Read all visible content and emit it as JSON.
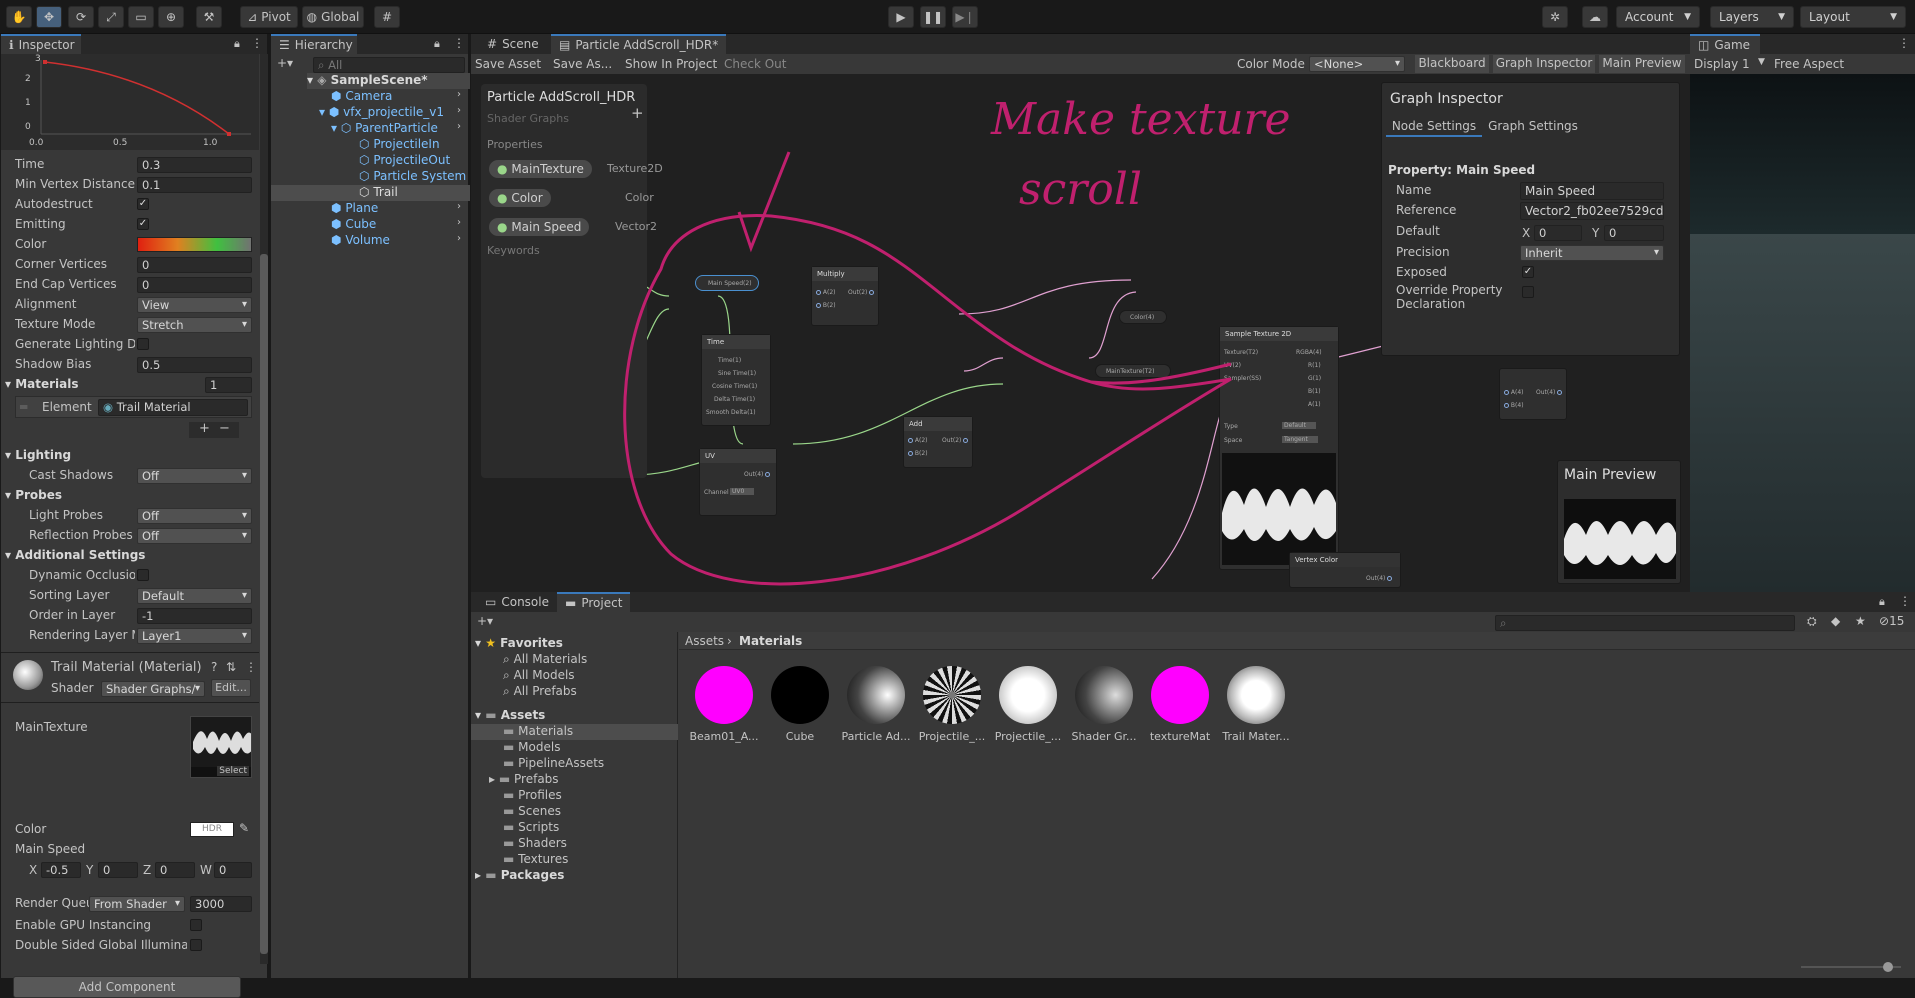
{
  "toolbar": {
    "pivot": "Pivot",
    "global": "Global",
    "account": "Account",
    "layers": "Layers",
    "layout": "Layout"
  },
  "inspector": {
    "tab": "Inspector",
    "curve_labels": {
      "y3": "3",
      "y2": "2",
      "y1": "1",
      "y0": "0",
      "x0": "0.0",
      "x05": "0.5",
      "x1": "1.0"
    },
    "props": [
      {
        "label": "Time",
        "value": "0.3"
      },
      {
        "label": "Min Vertex Distance",
        "value": "0.1"
      }
    ],
    "autodestruct": "Autodestruct",
    "emitting": "Emitting",
    "color": "Color",
    "corner_vertices": {
      "label": "Corner Vertices",
      "value": "0"
    },
    "end_cap": {
      "label": "End Cap Vertices",
      "value": "0"
    },
    "alignment": {
      "label": "Alignment",
      "value": "View"
    },
    "texture_mode": {
      "label": "Texture Mode",
      "value": "Stretch"
    },
    "gen_lighting": "Generate Lighting Da",
    "shadow_bias": {
      "label": "Shadow Bias",
      "value": "0.5"
    },
    "materials": {
      "label": "Materials",
      "count": "1",
      "element": "Element",
      "material": "Trail Material"
    },
    "lighting": "Lighting",
    "cast_shadows": {
      "label": "Cast Shadows",
      "value": "Off"
    },
    "probes": "Probes",
    "light_probes": {
      "label": "Light Probes",
      "value": "Off"
    },
    "reflection_probes": {
      "label": "Reflection Probes",
      "value": "Off"
    },
    "additional": "Additional Settings",
    "dynamic_occ": "Dynamic Occlusion",
    "sorting_layer": {
      "label": "Sorting Layer",
      "value": "Default"
    },
    "order_in_layer": {
      "label": "Order in Layer",
      "value": "-1"
    },
    "rendering_layer": {
      "label": "Rendering Layer M",
      "value": "Layer1"
    },
    "mat_title": "Trail Material (Material)",
    "shader_label": "Shader",
    "shader_value": "Shader Graphs/",
    "edit": "Edit...",
    "main_texture": "MainTexture",
    "select": "Select",
    "color2": "Color",
    "hdr": "HDR",
    "main_speed": "Main Speed",
    "vec": {
      "x": "-0.5",
      "y": "0",
      "z": "0",
      "w": "0"
    },
    "render_queue": {
      "label": "Render Queu",
      "mode": "From Shader",
      "value": "3000"
    },
    "gpu": "Enable GPU Instancing",
    "double_sided": "Double Sided Global Illuminatic",
    "add_component": "Add Component"
  },
  "hierarchy": {
    "tab": "Hierarchy",
    "search": "All",
    "items": [
      "SampleScene*",
      "Camera",
      "vfx_projectile_v1",
      "ParentParticle",
      "ProjectileIn",
      "ProjectileOut",
      "Particle System",
      "Trail",
      "Plane",
      "Cube",
      "Volume"
    ]
  },
  "editor": {
    "tabs": [
      "Scene",
      "Particle AddScroll_HDR*",
      "Game"
    ],
    "actions": [
      "Save Asset",
      "Save As...",
      "Show In Project",
      "Check Out"
    ],
    "color_mode_label": "Color Mode",
    "color_mode": "<None>",
    "buttons": [
      "Blackboard",
      "Graph Inspector",
      "Main Preview"
    ],
    "display": "Display 1",
    "aspect": "Free Aspect"
  },
  "blackboard": {
    "title": "Particle AddScroll_HDR",
    "subtitle": "Shader Graphs",
    "properties": "Properties",
    "keywords": "Keywords",
    "items": [
      {
        "name": "MainTexture",
        "type": "Texture2D"
      },
      {
        "name": "Color",
        "type": "Color"
      },
      {
        "name": "Main Speed",
        "type": "Vector2"
      }
    ]
  },
  "graph_inspector": {
    "title": "Graph Inspector",
    "tabs": [
      "Node Settings",
      "Graph Settings"
    ],
    "property": "Property: Main Speed",
    "name_label": "Name",
    "name": "Main Speed",
    "ref_label": "Reference",
    "ref": "Vector2_fb02ee7529cd",
    "default_label": "Default",
    "dx": "0",
    "dy": "0",
    "precision_label": "Precision",
    "precision": "Inherit",
    "exposed": "Exposed",
    "override": "Override Property",
    "override2": "Declaration"
  },
  "main_preview": "Main Preview",
  "annotation": {
    "line1": "Make texture",
    "line2": "scroll"
  },
  "nodes": {
    "main_speed": "Main Speed(2)",
    "multiply": "Multiply",
    "time": "Time",
    "add": "Add",
    "uv": "UV",
    "color": "Color(4)",
    "maintex": "MainTexture(T2)",
    "sample": "Sample Texture 2D",
    "vertex": "Vertex Color",
    "a2": "A(2)",
    "b2": "B(2)",
    "out2": "Out(2)",
    "a4": "A(4)",
    "b4": "B(4)",
    "out4": "Out(4)",
    "time_ports": [
      "Time(1)",
      "Sine Time(1)",
      "Cosine Time(1)",
      "Delta Time(1)",
      "Smooth Delta(1)"
    ],
    "channel": "Channel",
    "uv0": "UV0",
    "sample_in": [
      "Texture(T2)",
      "UV(2)",
      "Sampler(SS)"
    ],
    "sample_out": [
      "RGBA(4)",
      "R(1)",
      "G(1)",
      "B(1)",
      "A(1)"
    ],
    "type": "Type",
    "type_v": "Default",
    "space": "Space",
    "space_v": "Tangent"
  },
  "console_tab": "Console",
  "project_tab": "Project",
  "project": {
    "favorites": "Favorites",
    "fav_items": [
      "All Materials",
      "All Models",
      "All Prefabs"
    ],
    "assets": "Assets",
    "folders": [
      "Materials",
      "Models",
      "PipelineAssets",
      "Prefabs",
      "Profiles",
      "Scenes",
      "Scripts",
      "Shaders",
      "Textures"
    ],
    "packages": "Packages",
    "breadcrumb": [
      "Assets",
      "Materials"
    ],
    "thumbs": [
      "Beam01_A...",
      "Cube",
      "Particle Ad...",
      "Projectile_...",
      "Projectile_...",
      "Shader Gr...",
      "textureMat",
      "Trail Mater..."
    ],
    "hidden_count": "15"
  }
}
